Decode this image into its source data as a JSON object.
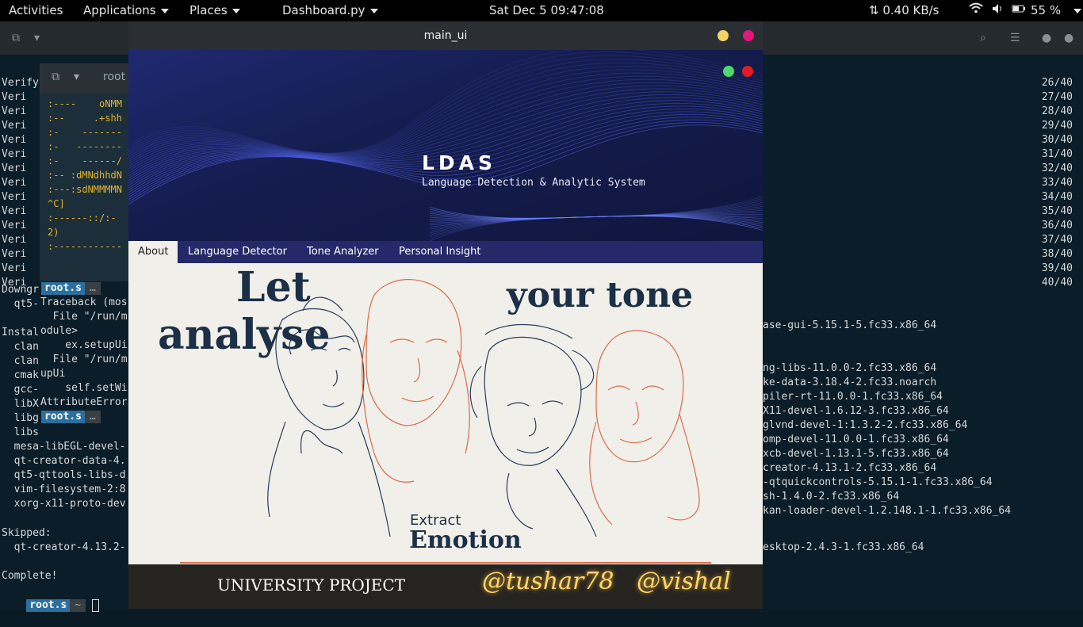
{
  "topbar": {
    "activities": "Activities",
    "applications": "Applications",
    "places": "Places",
    "app": "Dashboard.py",
    "clock": "Sat Dec 5  09:47:08",
    "net": "⇅ 0.40 KB/s",
    "battery": "55 %"
  },
  "bg_terminal": {
    "left_lines": [
      "Verifying",
      "Veri",
      "Veri",
      "Veri",
      "Veri",
      "Veri",
      "Veri",
      "Veri",
      "Veri",
      "Veri",
      "Veri",
      "Veri",
      "Veri",
      "Veri",
      "Veri"
    ],
    "right_numbers": [
      "26/40",
      "27/40",
      "28/40",
      "29/40",
      "30/40",
      "31/40",
      "32/40",
      "33/40",
      "34/40",
      "35/40",
      "36/40",
      "37/40",
      "38/40",
      "39/40",
      "40/40"
    ],
    "mid_lines": [
      "Downgr",
      "  qt5-",
      "",
      "Instal",
      "  clan",
      "  clan",
      "  cmak",
      "  gcc-",
      "  libX",
      "  libg",
      "  libs",
      "  mesa-libEGL-devel-",
      "  qt-creator-data-4.",
      "  qt5-qttools-libs-d",
      "  vim-filesystem-2:8",
      "  xorg-x11-proto-dev"
    ],
    "right_packages": [
      "ase-gui-5.15.1-5.fc33.x86_64",
      "",
      "",
      "ng-libs-11.0.0-2.fc33.x86_64",
      "ke-data-3.18.4-2.fc33.noarch",
      "piler-rt-11.0.0-1.fc33.x86_64",
      "X11-devel-1.6.12-3.fc33.x86_64",
      "glvnd-devel-1:1.3.2-2.fc33.x86_64",
      "omp-devel-11.0.0-1.fc33.x86_64",
      "xcb-devel-1.13.1-5.fc33.x86_64",
      "creator-4.13.1-2.fc33.x86_64",
      "-qtquickcontrols-5.15.1-1.fc33.x86_64",
      "sh-1.4.0-2.fc33.x86_64",
      "kan-loader-devel-1.2.148.1-1.fc33.x86_64"
    ],
    "skipped_label": "Skipped:",
    "skipped_item": "  qt-creator-4.13.2-",
    "skipped_right": "esktop-2.4.3-1.fc33.x86_64",
    "complete": "Complete!",
    "prompt": "root.s",
    "prompt_tail": "~"
  },
  "term2": {
    "title": "root",
    "lines": [
      ":----    oNMM",
      ":--     .+shh",
      ":-    -------",
      ":-   --------",
      ":-    ------/",
      ":-- :dMNdhhdN",
      ":---:sdNMMMMN",
      "^C]",
      ":------::/:-",
      "2)",
      ":------------"
    ]
  },
  "traceback": {
    "prompt": "root.s",
    "prompt2": "root.s",
    "lines": [
      "Traceback (mos",
      "  File \"/run/m",
      "odule>",
      "    ex.setupUi",
      "  File \"/run/m",
      "upUi",
      "    self.setWi",
      "AttributeError"
    ]
  },
  "window": {
    "title": "main_ui",
    "app_title": "LDAS",
    "app_subtitle": "Language Detection & Analytic System",
    "tabs": [
      "About",
      "Language Detector",
      "Tone Analyzer",
      "Personal Insight"
    ],
    "hero": {
      "line1": "Let",
      "line2": "analyse",
      "line3": "your tone",
      "extract": "Extract",
      "emotion": "Emotion"
    },
    "footer": {
      "project": "UNIVERSITY PROJECT",
      "handle1": "@tushar78",
      "handle2": "@vishal"
    },
    "colors": {
      "banner": "#151d50",
      "tabbar": "#25296a",
      "footer": "#262421",
      "neon": "#ffd56b"
    }
  }
}
